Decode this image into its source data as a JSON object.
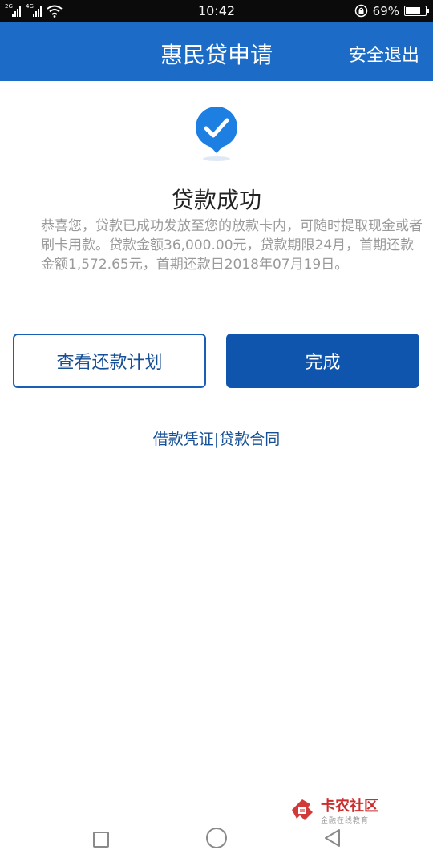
{
  "status_bar": {
    "sim1_label": "2G",
    "sim2_label": "4G",
    "time": "10:42",
    "battery_percent": "69%",
    "battery_level": 0.69,
    "icons": [
      "signal-2g-icon",
      "signal-4g-icon",
      "wifi-icon",
      "rotation-lock-icon",
      "battery-icon"
    ]
  },
  "header": {
    "title": "惠民贷申请",
    "logout_label": "安全退出",
    "background_color": "#1c6bc7"
  },
  "result": {
    "icon": "check-badge-icon",
    "title": "贷款成功",
    "description": "恭喜您，贷款已成功发放至您的放款卡内，可随时提取现金或者刷卡用款。贷款金额36,000.00元，贷款期限24月，首期还款金额1,572.65元，首期还款日2018年07月19日。"
  },
  "actions": {
    "view_plan_label": "查看还款计划",
    "done_label": "完成",
    "accent_color": "#0f55ad"
  },
  "links": {
    "voucher_label": "借款凭证",
    "separator": "|",
    "contract_label": "贷款合同"
  },
  "watermark": {
    "name": "卡农社区",
    "subtitle": "金融在线教育"
  },
  "nav_bar": {
    "icons": [
      "recent-apps-icon",
      "home-icon",
      "back-icon"
    ]
  }
}
